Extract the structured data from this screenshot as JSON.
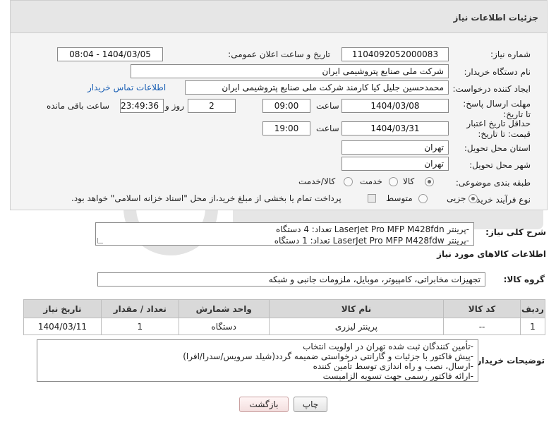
{
  "header": {
    "title": "جزئیات اطلاعات نیاز"
  },
  "fields": {
    "need_number": {
      "label": "شماره نیاز:",
      "value": "1104092052000083"
    },
    "announce_datetime": {
      "label": "تاریخ و ساعت اعلان عمومی:",
      "value": "1404/03/05 - 08:04"
    },
    "buyer_org": {
      "label": "نام دستگاه خریدار:",
      "value": "شرکت ملی صنایع پتروشیمی ایران"
    },
    "requester": {
      "label": "ایجاد کننده درخواست:",
      "value": "محمدحسین جلیل کیا کارمند شرکت ملی صنایع پتروشیمی ایران",
      "contact_link": "اطلاعات تماس خریدار"
    },
    "reply_deadline": {
      "label": "مهلت ارسال پاسخ: تا تاریخ:",
      "date": "1404/03/08",
      "time_label": "ساعت",
      "time": "09:00",
      "days": "2",
      "days_label": "روز و",
      "remaining": "23:49:36",
      "remaining_label": "ساعت باقی مانده"
    },
    "price_validity": {
      "label": "حداقل تاریخ اعتبار قیمت: تا تاریخ:",
      "date": "1404/03/31",
      "time_label": "ساعت",
      "time": "19:00"
    },
    "delivery_province": {
      "label": "استان محل تحویل:",
      "value": "تهران"
    },
    "delivery_city": {
      "label": "شهر محل تحویل:",
      "value": "تهران"
    },
    "category": {
      "label": "طبقه بندی موضوعی:",
      "options": [
        "کالا",
        "خدمت",
        "کالا/خدمت"
      ],
      "selected": "کالا"
    },
    "process_type": {
      "label": "نوع فرآیند خرید :",
      "options": [
        "جزیی",
        "متوسط"
      ],
      "selected": "جزیی",
      "payment_note": "پرداخت تمام یا بخشی از مبلغ خرید،از محل \"اسناد خزانه اسلامی\" خواهد بود."
    }
  },
  "summary": {
    "label": "شرح کلی نیاز:",
    "lines": [
      "-پرینتر LaserJet Pro MFP M428fdn  تعداد: 4 دستگاه",
      "-پرینتر LaserJet Pro MFP M428fdw  تعداد: 1 دستگاه"
    ]
  },
  "goods_info": {
    "title": "اطلاعات کالاهای مورد نیاز",
    "group_label": "گروه کالا:",
    "group_value": "تجهیزات مخابراتی، کامپیوتر، موبایل، ملزومات جانبی و شبکه"
  },
  "table": {
    "headers": [
      "ردیف",
      "کد کالا",
      "نام کالا",
      "واحد شمارش",
      "تعداد / مقدار",
      "تاریخ نیاز"
    ],
    "rows": [
      [
        "1",
        "--",
        "پرینتر لیزری",
        "دستگاه",
        "1",
        "1404/03/11"
      ]
    ]
  },
  "buyer_notes": {
    "label": "توضیحات خریدار:",
    "lines": [
      "-تأمین کنندگان ثبت شده تهران در اولویت انتخاب",
      "-پیش فاکتور با جزئیات و گارانتی درخواستی ضمیمه گردد(شیلد سرویس/سدرا/افرا)",
      "-ارسال، نصب و راه اندازی توسط تأمین کننده",
      "-ارائه فاکتور رسمی جهت تسویه الزامیست"
    ]
  },
  "buttons": {
    "print": "چاپ",
    "back": "بازگشت"
  },
  "colors": {
    "link": "#1a5fb4",
    "header_bg": "#e6e6e6",
    "table_header_bg": "#d9d9d9"
  },
  "watermark_icon": "aria-tender-logo"
}
